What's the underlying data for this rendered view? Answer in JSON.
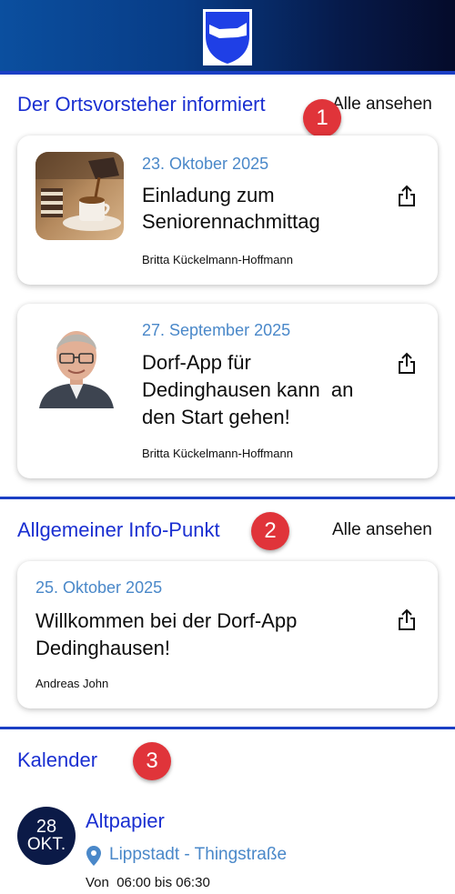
{
  "sections": {
    "ortsvorsteher": {
      "title": "Der Ortsvorsteher informiert",
      "see_all": "Alle ansehen",
      "badge": "1",
      "cards": [
        {
          "date": "23. Oktober 2025",
          "title_line1": "Einladung zum",
          "title_line2": "Seniorennachmittag",
          "author": "Britta Kückelmann-Hoffmann"
        },
        {
          "date": "27. September 2025",
          "title_line1": "Dorf-App für",
          "title_line2": "Dedinghausen kann  an",
          "title_line3": "den Start gehen!",
          "author": "Britta Kückelmann-Hoffmann"
        }
      ]
    },
    "infopunkt": {
      "title": "Allgemeiner Info-Punkt",
      "see_all": "Alle ansehen",
      "badge": "2",
      "cards": [
        {
          "date": "25. Oktober 2025",
          "title_line1": "Willkommen bei der Dorf-App",
          "title_line2": "Dedinghausen!",
          "author": "Andreas John"
        }
      ]
    },
    "kalender": {
      "title": "Kalender",
      "badge": "3",
      "event": {
        "day": "28",
        "month": "OKT.",
        "title": "Altpapier",
        "location": "Lippstadt - Thingstraße",
        "time": "Von  06:00 bis 06:30"
      }
    }
  },
  "icons": {
    "share": "share-icon",
    "location": "location-pin-icon",
    "logo": "coat-of-arms-logo"
  },
  "colors": {
    "accent_blue": "#1a2fd1",
    "date_blue": "#4a88c9",
    "badge_red": "#e0343a",
    "calendar_navy": "#0b1a47"
  }
}
